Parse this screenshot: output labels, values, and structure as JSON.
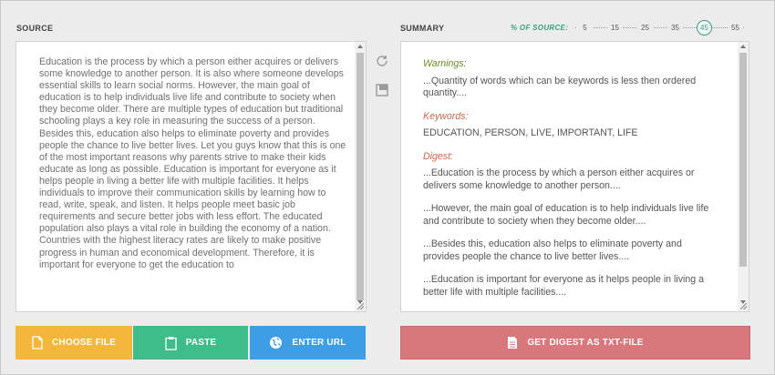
{
  "source": {
    "label": "SOURCE",
    "text": "Education is the process by which a person either acquires or delivers some knowledge to another person. It is also where someone develops essential skills to learn social norms. However, the main goal of education is to help individuals live life and contribute to society when they become older. There are multiple types of education but traditional schooling plays a key role in measuring the success of a person. Besides this, education also helps to eliminate poverty and provides people the chance to live better lives. Let you guys know that this is one of the most important reasons why parents strive to make their kids educate as long as possible. Education is important for everyone as it helps people in living a better life with multiple facilities. It helps individuals to improve their communication skills by learning how to read, write, speak, and listen. It helps people meet basic job requirements and secure better jobs with less effort. The educated population also plays a vital role in building the economy of a nation. Countries with the highest literacy rates are likely to make positive progress in human and economical development. Therefore, it is important for everyone to get the education to"
  },
  "summary": {
    "label": "SUMMARY",
    "pct_label": "% OF SOURCE:",
    "pct_options": [
      "5",
      "15",
      "25",
      "35",
      "45",
      "55"
    ],
    "pct_selected": "45",
    "warnings_heading": "Warnings:",
    "warnings_text": "...Quantity of words which can be keywords is less then ordered quantity....",
    "keywords_heading": "Keywords:",
    "keywords_text": "EDUCATION, PERSON, LIVE, IMPORTANT, LIFE",
    "digest_heading": "Digest:",
    "digest_items": [
      "...Education is the process by which a person either acquires or delivers some knowledge to another person....",
      "...However, the main goal of education is to help individuals live life and contribute to society when they become older....",
      "...Besides this, education also helps to eliminate poverty and provides people the chance to live better lives....",
      "...Education is important for everyone as it helps people in living a better life with multiple facilities...."
    ]
  },
  "buttons": {
    "choose_file": "CHOOSE FILE",
    "paste": "PASTE",
    "enter_url": "ENTER URL",
    "get_digest": "GET DIGEST AS TXT-FILE"
  },
  "icons": {
    "refresh": "refresh-icon",
    "copy": "copy-icon",
    "file": "file-icon",
    "clipboard": "clipboard-icon",
    "globe": "globe-icon",
    "document": "document-icon"
  },
  "colors": {
    "choose_file": "#f4b73c",
    "paste": "#3ebd8b",
    "enter_url": "#3d9ee5",
    "get_digest": "#d9787c",
    "accent": "#3aa07e"
  }
}
